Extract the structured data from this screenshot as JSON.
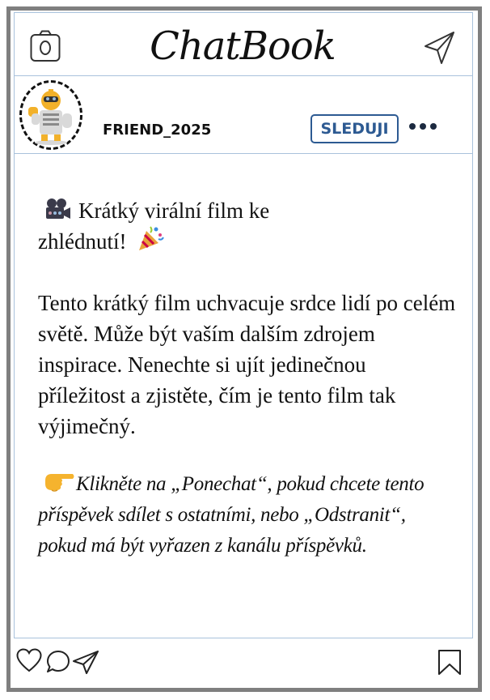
{
  "app": {
    "title": "ChatBook"
  },
  "profile": {
    "username": "FRIEND_2025",
    "follow_label": "SLEDUJI"
  },
  "post": {
    "line1_text": "Krátký virální film ke",
    "line2_text": "zhlédnutí!",
    "body": "Tento krátký film uchvacuje srdce lidí po celém světě. Může být vaším dalším zdrojem inspirace. Nenechte si ujít jedinečnou příležitost a zjistěte, čím je tento film tak výjimečný.",
    "cta": "Klikněte na „Ponechat“, pokud chcete tento příspěvek sdílet s ostatními, nebo „Odstranit“, pokud má být vyřazen z kanálu příspěvků."
  },
  "icons": {
    "camera": "camera-icon",
    "send": "send-icon",
    "more": "more-dots-icon",
    "film_camera": "film-camera-emoji",
    "party": "party-popper-emoji",
    "pointing": "pointing-hand-emoji",
    "heart": "heart-icon",
    "comment": "comment-icon",
    "share": "share-icon",
    "bookmark": "bookmark-icon"
  },
  "colors": {
    "frame": "#7f7f7f",
    "divider": "#a9c2dc",
    "accent": "#2d5a92"
  }
}
